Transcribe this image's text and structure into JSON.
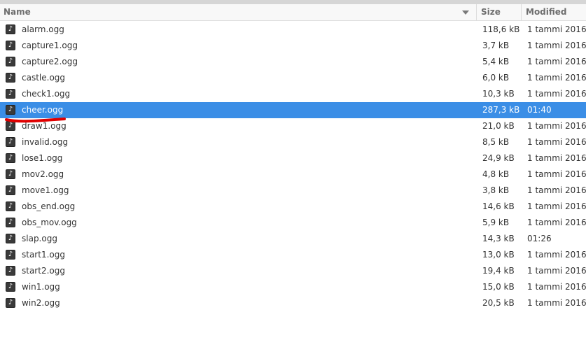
{
  "header": {
    "name": "Name",
    "size": "Size",
    "modified": "Modified"
  },
  "icons": {
    "file": "audio-file-icon",
    "glyph": "♪",
    "sort": "sort-descending-icon"
  },
  "colors": {
    "selection": "#3b8ee6",
    "annotation": "#e00000"
  },
  "selected_index": 5,
  "files": [
    {
      "name": "alarm.ogg",
      "size": "118,6 kB",
      "modified": "1 tammi 2016"
    },
    {
      "name": "capture1.ogg",
      "size": "3,7 kB",
      "modified": "1 tammi 2016"
    },
    {
      "name": "capture2.ogg",
      "size": "5,4 kB",
      "modified": "1 tammi 2016"
    },
    {
      "name": "castle.ogg",
      "size": "6,0 kB",
      "modified": "1 tammi 2016"
    },
    {
      "name": "check1.ogg",
      "size": "10,3 kB",
      "modified": "1 tammi 2016"
    },
    {
      "name": "cheer.ogg",
      "size": "287,3 kB",
      "modified": "01:40"
    },
    {
      "name": "draw1.ogg",
      "size": "21,0 kB",
      "modified": "1 tammi 2016"
    },
    {
      "name": "invalid.ogg",
      "size": "8,5 kB",
      "modified": "1 tammi 2016"
    },
    {
      "name": "lose1.ogg",
      "size": "24,9 kB",
      "modified": "1 tammi 2016"
    },
    {
      "name": "mov2.ogg",
      "size": "4,8 kB",
      "modified": "1 tammi 2016"
    },
    {
      "name": "move1.ogg",
      "size": "3,8 kB",
      "modified": "1 tammi 2016"
    },
    {
      "name": "obs_end.ogg",
      "size": "14,6 kB",
      "modified": "1 tammi 2016"
    },
    {
      "name": "obs_mov.ogg",
      "size": "5,9 kB",
      "modified": "1 tammi 2016"
    },
    {
      "name": "slap.ogg",
      "size": "14,3 kB",
      "modified": "01:26"
    },
    {
      "name": "start1.ogg",
      "size": "13,0 kB",
      "modified": "1 tammi 2016"
    },
    {
      "name": "start2.ogg",
      "size": "19,4 kB",
      "modified": "1 tammi 2016"
    },
    {
      "name": "win1.ogg",
      "size": "15,0 kB",
      "modified": "1 tammi 2016"
    },
    {
      "name": "win2.ogg",
      "size": "20,5 kB",
      "modified": "1 tammi 2016"
    }
  ]
}
